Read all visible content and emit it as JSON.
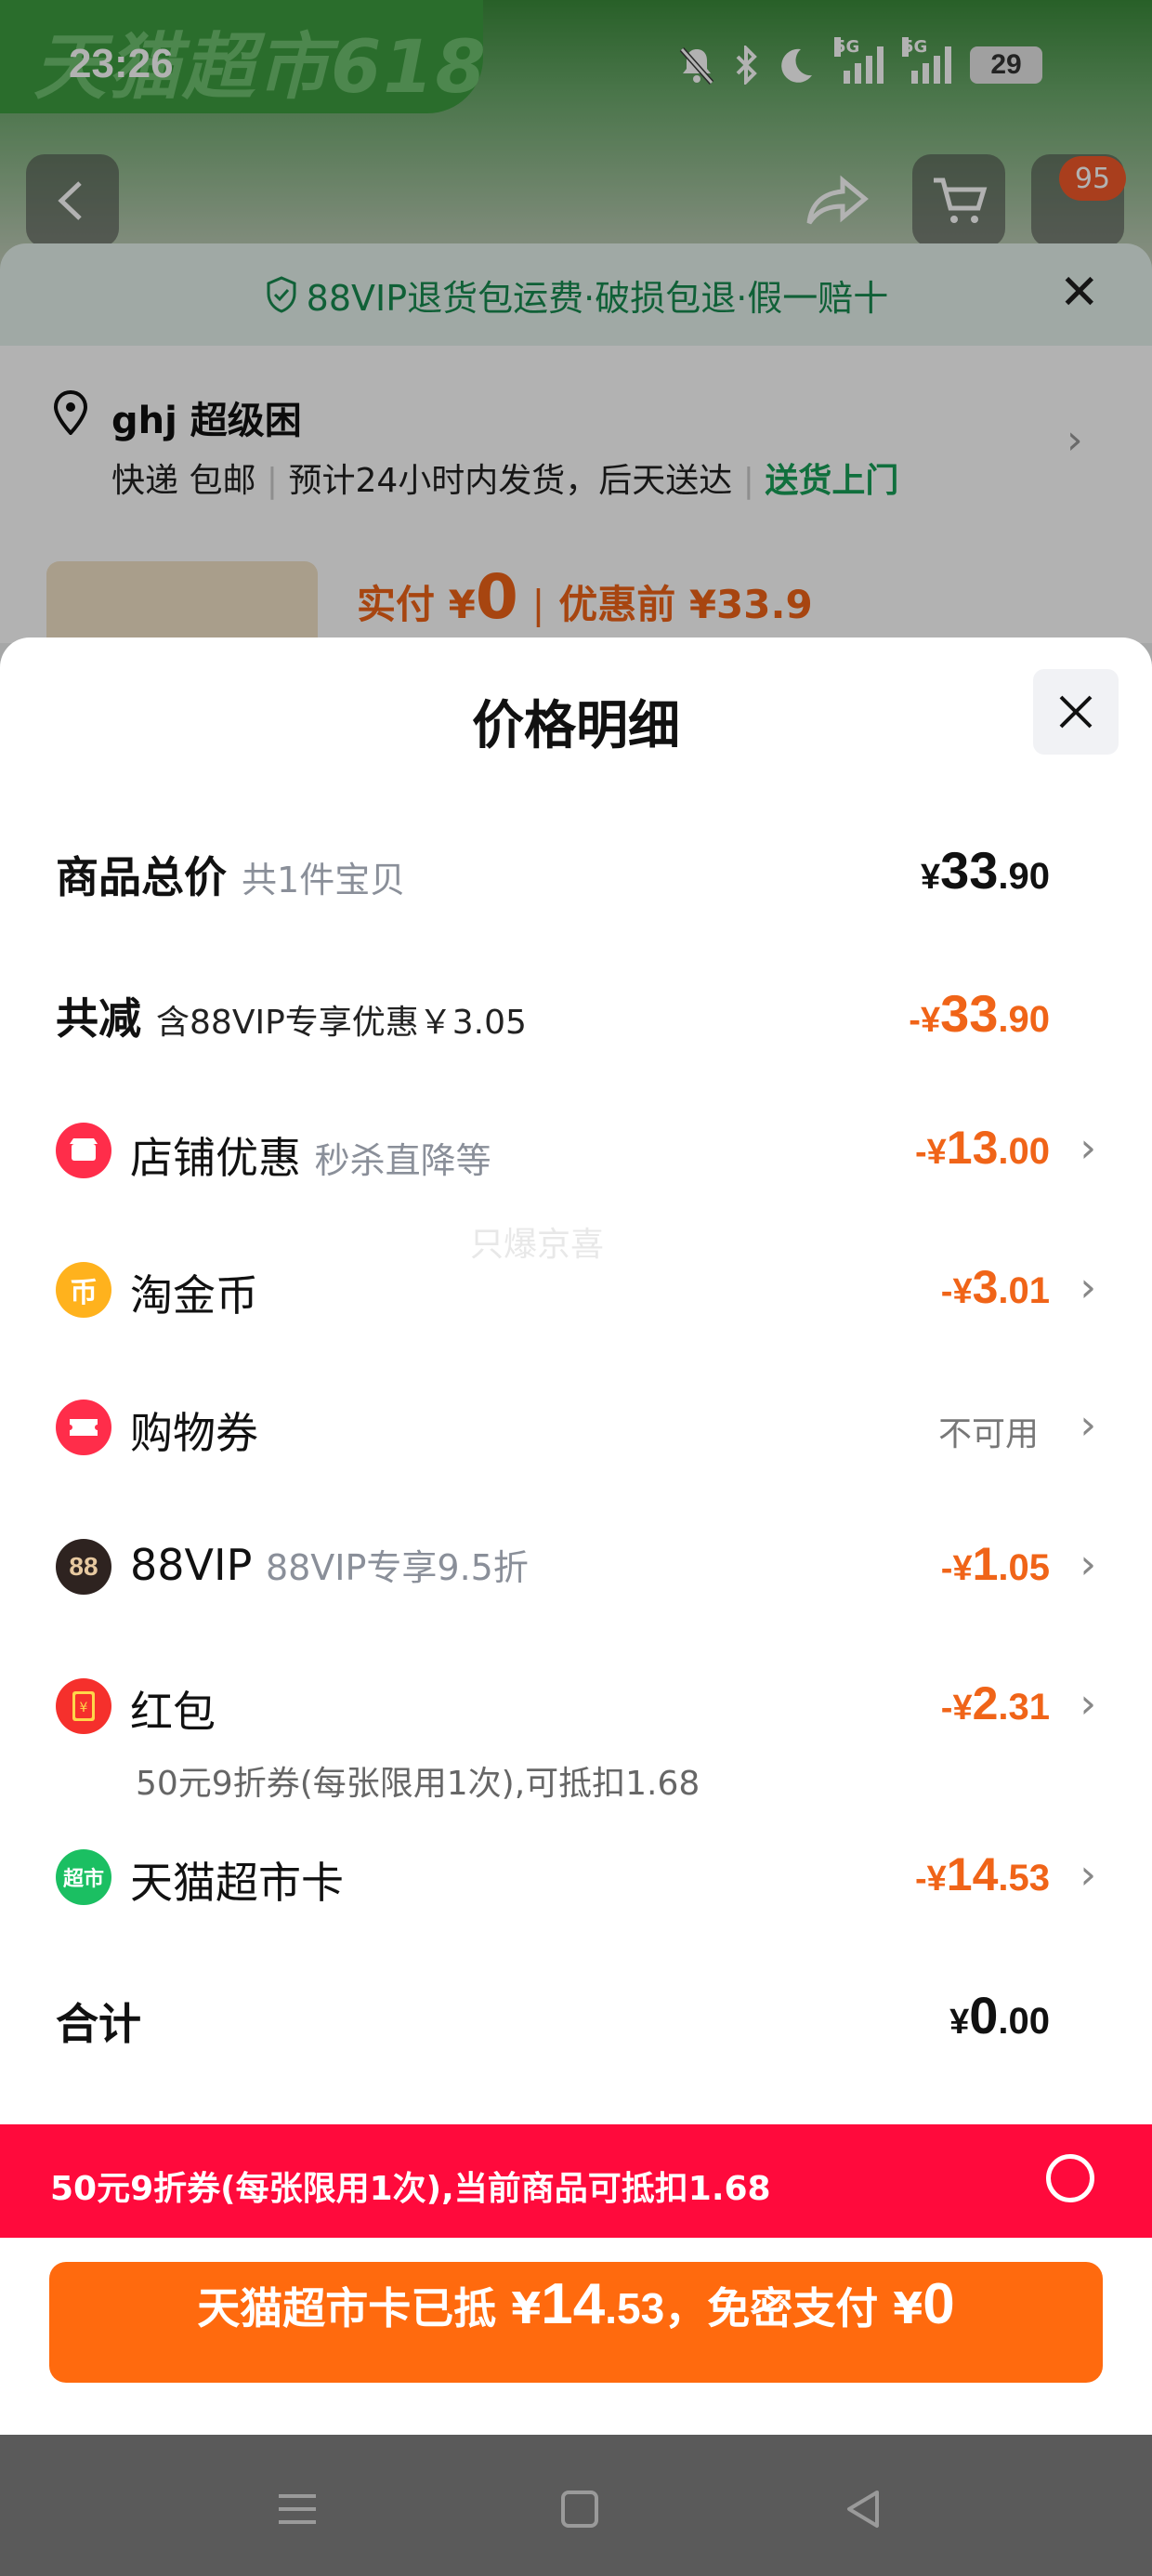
{
  "status_bar": {
    "time": "23:26",
    "battery": "29",
    "badge": "95"
  },
  "background": {
    "banner": "天猫超市618",
    "vip_strip": "88VIP退货包运费·破损包退·假一赔十",
    "address_name": "ghj 超级困",
    "delivery_a": "快递 包邮",
    "delivery_b": "预计24小时内发货，后天送达",
    "delivery_c": "送货上门",
    "pay_label": "实付 ¥",
    "pay_value": "0",
    "before_label": "优惠前 ¥33.9"
  },
  "sheet": {
    "title": "价格明细",
    "watermark": "只爆京喜",
    "rows": [
      {
        "label": "商品总价",
        "sub": "共1件宝贝",
        "sign": "",
        "sym": "¥",
        "int": "33",
        "dec": ".90"
      },
      {
        "label": "共减",
        "sub": "含88VIP专享优惠￥3.05",
        "sign": "-",
        "sym": "¥",
        "int": "33",
        "dec": ".90"
      },
      {
        "label": "店铺优惠",
        "sub": "秒杀直降等",
        "sign": "-",
        "sym": "¥",
        "int": "13",
        "dec": ".00"
      },
      {
        "label": "淘金币",
        "sub": "",
        "sign": "-",
        "sym": "¥",
        "int": "3",
        "dec": ".01"
      },
      {
        "label": "购物券",
        "sub": "",
        "status": "不可用"
      },
      {
        "label": "88VIP",
        "sub": "88VIP专享9.5折",
        "sign": "-",
        "sym": "¥",
        "int": "1",
        "dec": ".05"
      },
      {
        "label": "红包",
        "sub": "",
        "sign": "-",
        "sym": "¥",
        "int": "2",
        "dec": ".31",
        "note": "50元9折券(每张限用1次),可抵扣1.68"
      },
      {
        "label": "天猫超市卡",
        "sub": "",
        "sign": "-",
        "sym": "¥",
        "int": "14",
        "dec": ".53"
      },
      {
        "label": "合计",
        "sub": "",
        "sign": "",
        "sym": "¥",
        "int": "0",
        "dec": ".00"
      }
    ]
  },
  "coupon_bar": {
    "text": "50元9折券(每张限用1次),当前商品可抵扣1.68"
  },
  "pay_button": {
    "part1": "天猫超市卡已抵 ¥",
    "amount_int": "14",
    "amount_dec": ".53",
    "part2": "，免密支付 ¥",
    "total": "0"
  },
  "colors": {
    "accent": "#f06418",
    "red_bar": "#ff0a3c",
    "pay_button": "#ff6a0e",
    "green": "#18a058"
  },
  "icons": [
    "bell-off-icon",
    "bluetooth-icon",
    "moon-icon",
    "signal-icon",
    "battery-icon",
    "back-icon",
    "share-icon",
    "cart-icon",
    "shield-check-icon",
    "close-icon",
    "location-pin-icon",
    "chevron-right-icon",
    "shop-coupon-icon",
    "coin-icon",
    "ticket-icon",
    "vip-icon",
    "red-packet-icon",
    "supermarket-card-icon",
    "radio-icon",
    "menu-icon",
    "home-icon",
    "nav-back-icon"
  ]
}
